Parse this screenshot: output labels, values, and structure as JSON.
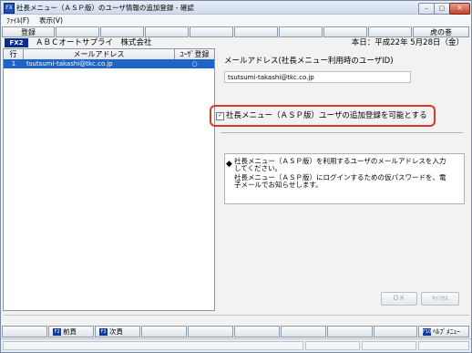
{
  "window": {
    "title": "社長メニュー（ＡＳＰ版）のユーザ情報の追加登録 - 確認",
    "app_icon": "FX",
    "controls": [
      "minimize-icon",
      "maximize-icon",
      "close-icon"
    ]
  },
  "menu": {
    "file": "ﾌｧｲﾙ(F)",
    "view": "表示(V)"
  },
  "toolbar": {
    "register": "登録",
    "tora_no_maki": "虎の巻"
  },
  "infobar": {
    "badge": "FX2",
    "company": "ＡＢＣオートサプライ　株式会社",
    "date": "本日：平成22年 5月28日（金）"
  },
  "table": {
    "headers": {
      "row": "行",
      "email": "メールアドレス",
      "user_reg": "ﾕｰｻﾞ登録"
    },
    "rows": [
      {
        "num": "1",
        "email": "tsutsumi-takashi@tkc.co.jp",
        "reg": "○"
      }
    ]
  },
  "detail": {
    "email_label": "メールアドレス(社長メニュー利用時のユーザID)",
    "email_value": "tsutsumi-takashi@tkc.co.jp",
    "checkbox_label": "社長メニュー（ＡＳＰ版）ユーザの追加登録を可能とする",
    "checkbox_checked": true,
    "info_lines": [
      "社長メニュー（ＡＳＰ版）を利用するユーザのメールアドレスを入力",
      "してください。",
      "社長メニュー（ＡＳＰ版）にログインするための仮パスワードを、電",
      "子メールでお知らせします。"
    ],
    "ok": "ＯＫ",
    "cancel": "ｷｬﾝｾﾙ"
  },
  "fkeys": {
    "prev": "前頁",
    "next": "次頁",
    "help": "ﾍﾙﾌﾟﾒﾆｭｰ"
  }
}
